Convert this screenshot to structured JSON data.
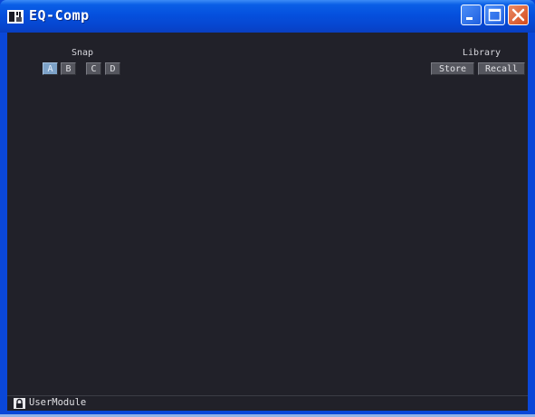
{
  "window": {
    "title": "EQ-Comp",
    "icon": "app-module-icon",
    "controls": {
      "minimize": "minimize-icon",
      "maximize": "maximize-icon",
      "close": "close-icon"
    },
    "colors": {
      "titlebar": "#0550de",
      "client": "#212129",
      "close": "#d44a1c"
    }
  },
  "snap": {
    "label": "Snap",
    "buttons": [
      "A",
      "B",
      "C",
      "D"
    ],
    "active": "A"
  },
  "library": {
    "label": "Library",
    "store": "Store",
    "recall": "Recall"
  },
  "status": {
    "icon": "lock-icon",
    "text": "UserModule"
  }
}
